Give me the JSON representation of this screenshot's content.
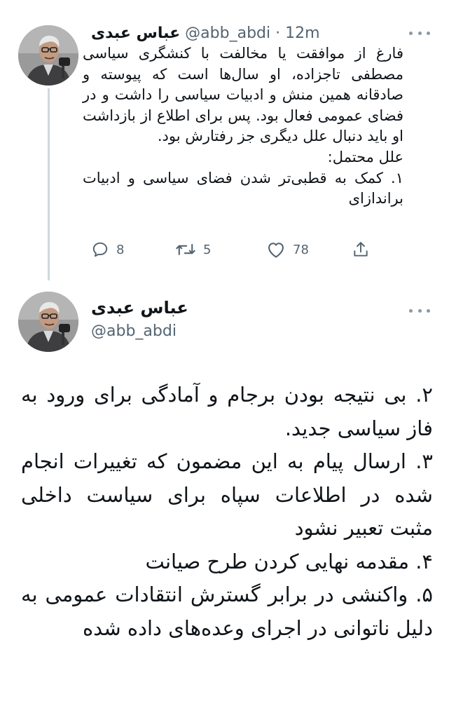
{
  "tweet1": {
    "author_name": "عباس عبدی",
    "handle": "@abb_abdi",
    "separator": "·",
    "time": "12m",
    "text": "فارغ از  موافقت یا مخالفت با کنشگری سیاسی مصطفی تاجزاده، او سال‌ها است که پیوسته و صادقانه همین منش و ادبیات سیاسی را داشت و در فضای عمومی فعال بود. پس برای اطلاع از بازداشت او باید دنبال علل دیگری جز رفتارش بود.\nعلل محتمل:\n۱. کمک به قطبی‌تر شدن فضای سیاسی و  ادبیات براندازای",
    "actions": {
      "replies": "8",
      "retweets": "5",
      "likes": "78"
    }
  },
  "tweet2": {
    "author_name": "عباس عبدی",
    "handle": "@abb_abdi",
    "text": "۲. بی نتیجه بودن برجام و آمادگی برای ورود به فاز سیاسی جدید.\n۳. ارسال پیام به این مضمون که تغییرات انجام شده در اطلاعات سپاه برای سیاست داخلی مثبت تعبیر نشود\n۴. مقدمه نهایی کردن طرح صیانت\n۵. واکنشی در برابر گسترش انتقادات عمومی به دلیل ناتوانی در اجرای وعده‌های داده شده"
  },
  "icons": {
    "more": "more-horizontal-icon",
    "reply": "reply-icon",
    "retweet": "retweet-icon",
    "like": "like-heart-icon",
    "share": "share-icon"
  },
  "colors": {
    "text": "#0f1419",
    "secondary": "#536471",
    "thread_line": "#cfd9de"
  }
}
